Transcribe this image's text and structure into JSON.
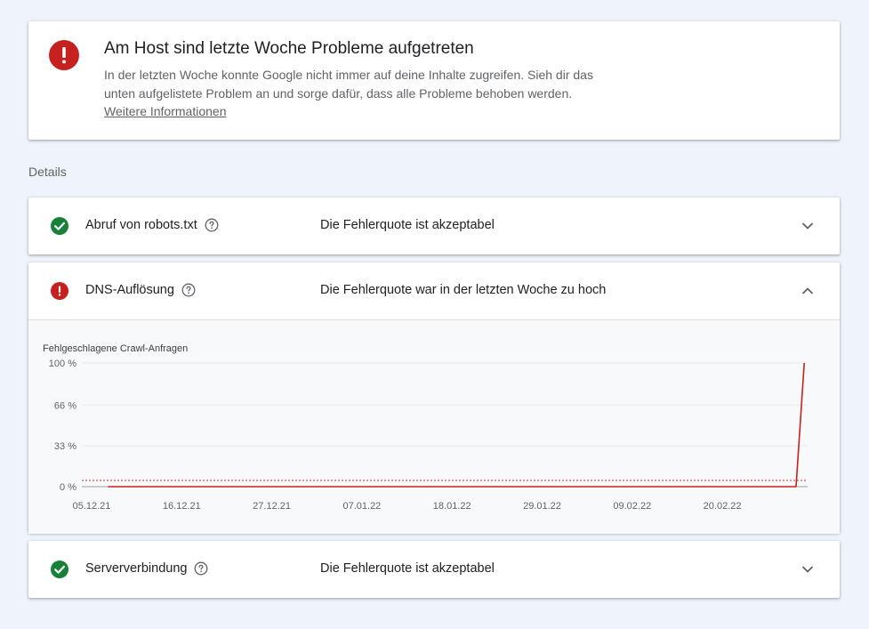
{
  "alert": {
    "icon": "error-icon",
    "title": "Am Host sind letzte Woche Probleme aufgetreten",
    "description": "In der letzten Woche konnte Google nicht immer auf deine Inhalte zugreifen. Sieh dir das unten aufgelistete Problem an und sorge dafür, dass alle Probleme behoben werden.",
    "link_label": "Weitere Informationen",
    "icon_color": "#c5221f"
  },
  "details": {
    "heading": "Details"
  },
  "rows": [
    {
      "label": "Abruf von robots.txt",
      "status": "Die Fehlerquote ist akzeptabel",
      "state": "ok",
      "expanded": false
    },
    {
      "label": "DNS-Auflösung",
      "status": "Die Fehlerquote war in der letzten Woche zu hoch",
      "state": "error",
      "expanded": true
    },
    {
      "label": "Serververbindung",
      "status": "Die Fehlerquote ist akzeptabel",
      "state": "ok",
      "expanded": false
    }
  ],
  "colors": {
    "ok": "#188038",
    "error": "#c5221f",
    "line": "#c5221f",
    "threshold": "#d93025"
  },
  "chart_data": {
    "type": "line",
    "title": "Fehlgeschlagene Crawl-Anfragen",
    "xlabel": "",
    "ylabel": "",
    "x_tick_labels": [
      "05.12.21",
      "16.12.21",
      "27.12.21",
      "07.01.22",
      "18.01.22",
      "29.01.22",
      "09.02.22",
      "20.02.22"
    ],
    "y_tick_labels": [
      "100 %",
      "66 %",
      "33 %",
      "0 %"
    ],
    "y_ticks": [
      100,
      66,
      33,
      0
    ],
    "ylim": [
      0,
      100
    ],
    "x_start": "2021-12-05",
    "x_end": "2022-03-03",
    "grid": true,
    "threshold": 5,
    "series": [
      {
        "points": [
          {
            "date": "2021-12-07",
            "value": 0
          },
          {
            "date": "2022-03-01",
            "value": 0
          },
          {
            "date": "2022-03-02",
            "value": 100
          }
        ]
      }
    ]
  }
}
